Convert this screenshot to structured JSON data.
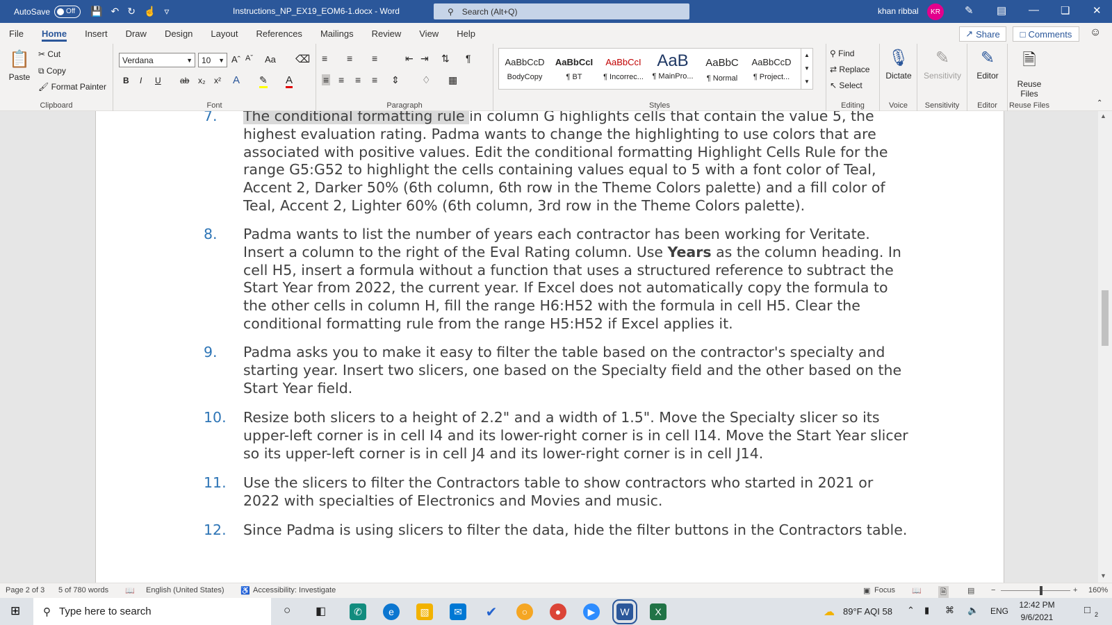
{
  "titlebar": {
    "autosave_label": "AutoSave",
    "autosave_state": "Off",
    "document_title": "Instructions_NP_EX19_EOM6-1.docx  -  Word",
    "search_placeholder": "Search (Alt+Q)",
    "user_name": "khan ribbal",
    "user_initials": "KR"
  },
  "tabs": [
    "File",
    "Home",
    "Insert",
    "Draw",
    "Design",
    "Layout",
    "References",
    "Mailings",
    "Review",
    "View",
    "Help"
  ],
  "active_tab": "Home",
  "share_label": "Share",
  "comments_label": "Comments",
  "ribbon": {
    "clipboard": {
      "paste": "Paste",
      "cut": "Cut",
      "copy": "Copy",
      "format_painter": "Format Painter",
      "label": "Clipboard"
    },
    "font": {
      "family": "Verdana",
      "size": "10",
      "label": "Font",
      "case_label": "Aa"
    },
    "paragraph": {
      "label": "Paragraph"
    },
    "styles": {
      "label": "Styles",
      "items": [
        {
          "preview": "AaBbCcD",
          "name": "BodyCopy"
        },
        {
          "preview": "AaBbCcI",
          "name": "¶ BT"
        },
        {
          "preview": "AaBbCcI",
          "name": "¶ Incorrec..."
        },
        {
          "preview": "AaB",
          "name": "¶ MainPro..."
        },
        {
          "preview": "AaBbC",
          "name": "¶ Normal"
        },
        {
          "preview": "AaBbCcD",
          "name": "¶ Project..."
        }
      ]
    },
    "editing": {
      "find": "Find",
      "replace": "Replace",
      "select": "Select",
      "label": "Editing"
    },
    "voice": {
      "dictate": "Dictate",
      "label": "Voice"
    },
    "sensitivity": {
      "button": "Sensitivity",
      "label": "Sensitivity"
    },
    "editor": {
      "button": "Editor",
      "label": "Editor"
    },
    "reuse": {
      "button_line1": "Reuse",
      "button_line2": "Files",
      "label": "Reuse Files"
    }
  },
  "document": {
    "items": [
      {
        "num": "7.",
        "highlight": "The conditional formatting rule ",
        "text": "in column G highlights cells that contain the value 5, the highest evaluation rating. Padma wants to change the highlighting to use colors that are associated with positive values. Edit the conditional formatting Highlight Cells Rule for the range G5:G52 to highlight the cells containing values equal to 5 with a font color of Teal, Accent 2, Darker 50% (6th column, 6th row in the Theme Colors palette) and a fill color of Teal, Accent 2, Lighter 60% (6th column, 3rd row in the Theme Colors palette)."
      },
      {
        "num": "8.",
        "text_before": "Padma wants to list the number of years each contractor has been working for Veritate. Insert a column to the right of the Eval Rating column. Use ",
        "bold": "Years",
        "text_after": " as the column heading. In cell H5, insert a formula without a function that uses a structured reference to subtract the Start Year from 2022, the current year. If Excel does not automatically copy the formula to the other cells in column H, fill the range H6:H52 with the formula in cell H5. Clear the conditional formatting rule from the range H5:H52 if Excel applies it."
      },
      {
        "num": "9.",
        "text": "Padma asks you to make it easy to filter the table based on the contractor's specialty and starting year. Insert two slicers, one based on the Specialty field and the other based on the Start Year field."
      },
      {
        "num": "10.",
        "text": "Resize both slicers to a height of 2.2\" and a width of 1.5\". Move the Specialty slicer so its upper-left corner is in cell I4 and its lower-right corner is in cell I14. Move the Start Year slicer so its upper-left corner is in cell J4 and its lower-right corner is in cell J14."
      },
      {
        "num": "11.",
        "text": "Use the slicers to filter the Contractors table to show contractors who started in 2021 or 2022 with specialties of Electronics and Movies and music."
      },
      {
        "num": "12.",
        "text": "Since Padma is using slicers to filter the data, hide the filter buttons in the Contractors table."
      }
    ]
  },
  "statusbar": {
    "page": "Page 2 of 3",
    "words": "5 of 780 words",
    "language": "English (United States)",
    "accessibility": "Accessibility: Investigate",
    "focus": "Focus",
    "zoom": "160%"
  },
  "taskbar": {
    "search_placeholder": "Type here to search",
    "weather": "89°F  AQI 58",
    "lang": "ENG",
    "time": "12:42 PM",
    "date": "9/6/2021",
    "notifications": "2"
  },
  "colors": {
    "word_blue": "#2b579a",
    "list_number": "#2e75b6",
    "body_text": "#404040",
    "avatar": "#e3008c"
  }
}
